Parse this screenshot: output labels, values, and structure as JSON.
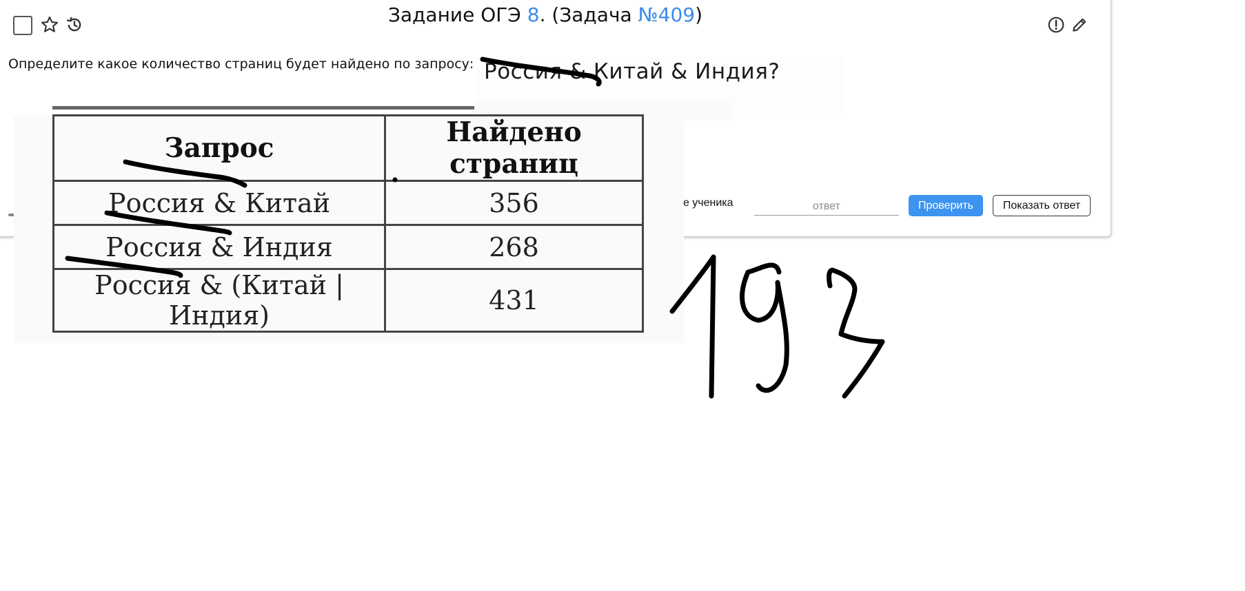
{
  "header": {
    "title_prefix": "Задание ОГЭ ",
    "task_number": "8",
    "title_middle": ". (Задача ",
    "problem_id": "№409",
    "title_suffix": ")"
  },
  "question": {
    "text": "Определите какое количество страниц будет найдено по запросу:",
    "query": "Россия & Китай & Индия?"
  },
  "table": {
    "headers": [
      "Запрос",
      "Найдено страниц"
    ],
    "rows": [
      {
        "query": "Россия & Китай",
        "pages": "356"
      },
      {
        "query": "Россия & Индия",
        "pages": "268"
      },
      {
        "query": "Россия & (Китай | Индия)",
        "pages": "431"
      }
    ]
  },
  "answer": {
    "label": "ие ученика",
    "placeholder": "ответ",
    "check_label": "Проверить",
    "show_label": "Показать ответ"
  },
  "handwriting": {
    "answer": "193"
  },
  "colors": {
    "link": "#3d8be8",
    "check_button": "#3d94f0",
    "ink": "#000000"
  }
}
